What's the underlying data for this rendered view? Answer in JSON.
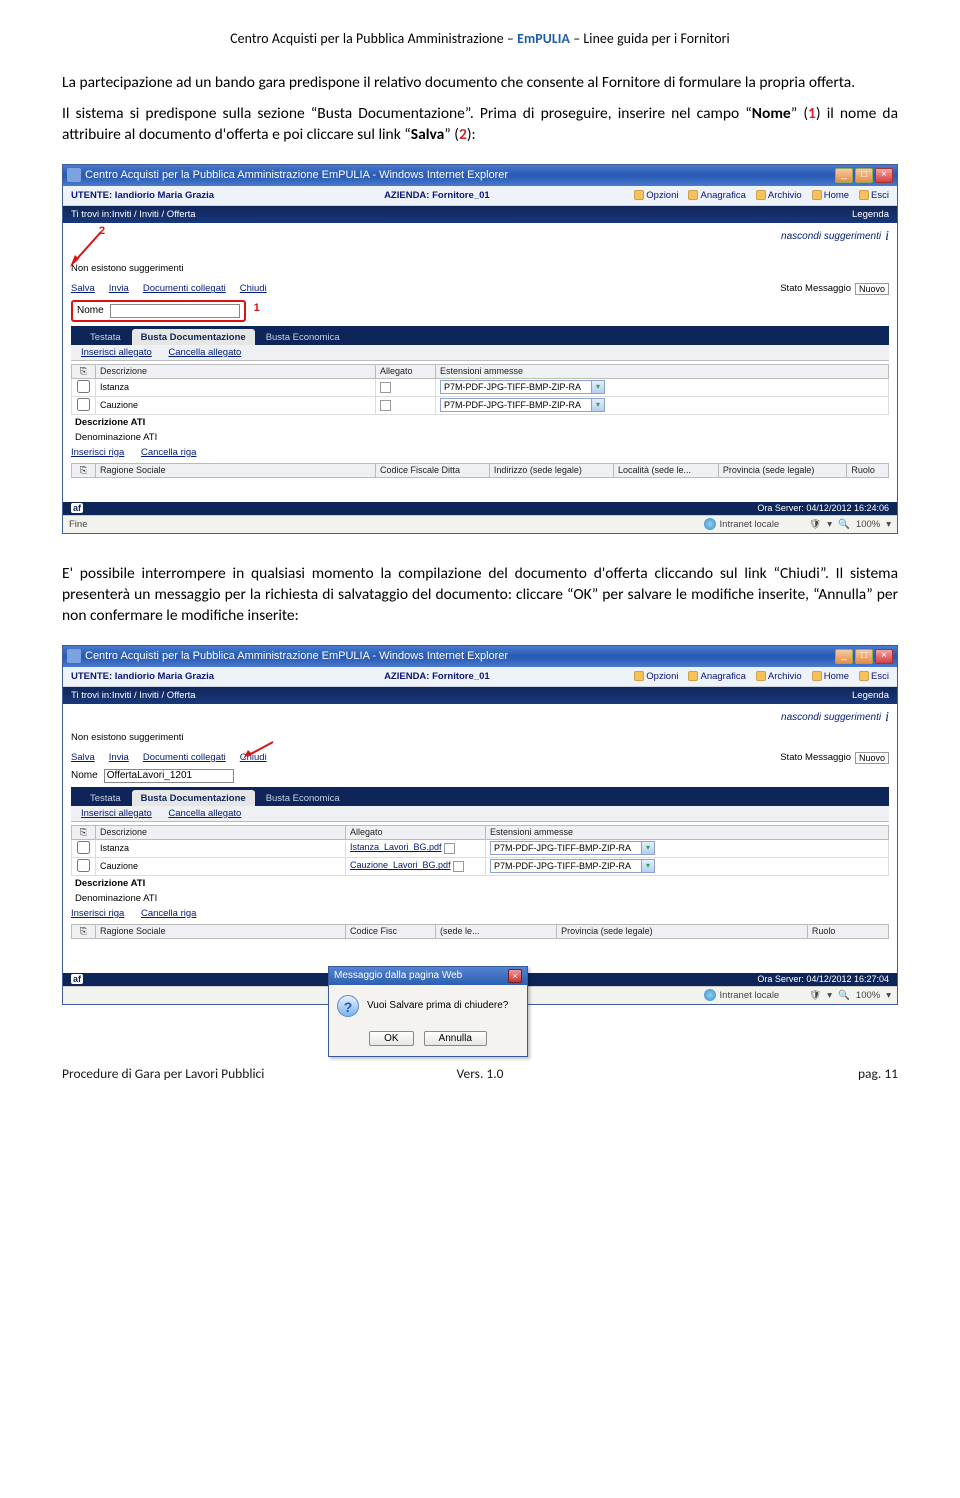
{
  "header": {
    "left": "Centro Acquisti per la Pubblica Amministrazione – ",
    "brand": "EmPULIA",
    "right": " – Linee guida per i Fornitori"
  },
  "para1": "La partecipazione ad un bando gara predispone il relativo documento che consente al Fornitore di formulare la propria offerta.",
  "para2_before": "Il sistema si predispone sulla sezione “Busta Documentazione”. Prima di proseguire, inserire nel campo “",
  "para2_nome": "Nome",
  "para2_mid1": "” (",
  "para2_num1": "1",
  "para2_mid2": ") il nome da attribuire al documento d'offerta e poi cliccare sul link “",
  "para2_salva": "Salva",
  "para2_mid3": "” (",
  "para2_num2": "2",
  "para2_end": "):",
  "para3": "E' possibile interrompere in qualsiasi momento la compilazione del documento d'offerta cliccando sul link “Chiudi”. Il sistema presenterà un messaggio per la richiesta di salvataggio del documento: cliccare “OK” per salvare le modifiche inserite, “Annulla” per non confermare le modifiche inserite:",
  "win": {
    "title": "Centro Acquisti per la Pubblica Amministrazione EmPULIA - Windows Internet Explorer",
    "user_label": "UTENTE: Iandiorio Maria Grazia",
    "azienda_label": "AZIENDA: Fornitore_01",
    "toolbar": {
      "opzioni": "Opzioni",
      "anagrafica": "Anagrafica",
      "archivio": "Archivio",
      "home": "Home",
      "esci": "Esci"
    },
    "breadcrumb": "Ti trovi in:Inviti / Inviti / Offerta",
    "legenda": "Legenda",
    "nascondi": "nascondi suggerimenti",
    "no_sugg": "Non esistono suggerimenti",
    "links": {
      "salva": "Salva",
      "invia": "Invia",
      "doccoll": "Documenti collegati",
      "chiudi": "Chiudi"
    },
    "stato_label": "Stato Messaggio",
    "stato_val": "Nuovo",
    "nome_label": "Nome",
    "nome_value2": "OffertaLavori_1201",
    "num1": "1",
    "num2": "2",
    "tabs": {
      "testata": "Testata",
      "busta_doc": "Busta Documentazione",
      "busta_eco": "Busta Economica"
    },
    "subtab": {
      "ins": "Inserisci allegato",
      "canc": "Cancella allegato"
    },
    "table": {
      "col_desc": "Descrizione",
      "col_all": "Allegato",
      "col_ext": "Estensioni ammesse",
      "row1": "Istanza",
      "row2": "Cauzione",
      "alle1": "Istanza_Lavori_BG.pdf",
      "alle2": "Cauzione_Lavori_BG.pdf",
      "ext": "P7M-PDF-JPG-TIFF-BMP-ZIP-RA"
    },
    "ati_label": "Descrizione ATI",
    "denom_label": "Denominazione ATI",
    "subtab2": {
      "ins": "Inserisci riga",
      "canc": "Cancella riga"
    },
    "cols2": {
      "rag": "Ragione Sociale",
      "cf": "Codice Fiscale Ditta",
      "ind": "Indirizzo (sede legale)",
      "loc": "Località (sede le...",
      "prov": "Provincia (sede legale)",
      "ruolo": "Ruolo"
    },
    "ora1": "Ora Server: 04/12/2012 16:24:06",
    "ora2": "Ora Server: 04/12/2012 16:27:04",
    "af": "af",
    "fine": "Fine",
    "intranet": "Intranet locale",
    "zoom": "100%"
  },
  "dialog": {
    "title": "Messaggio dalla pagina Web",
    "text": "Vuoi Salvare prima di chiudere?",
    "ok": "OK",
    "annulla": "Annulla"
  },
  "footer": {
    "left": "Procedure di Gara per Lavori Pubblici",
    "mid": "Vers. 1.0",
    "right": "pag. 11"
  }
}
